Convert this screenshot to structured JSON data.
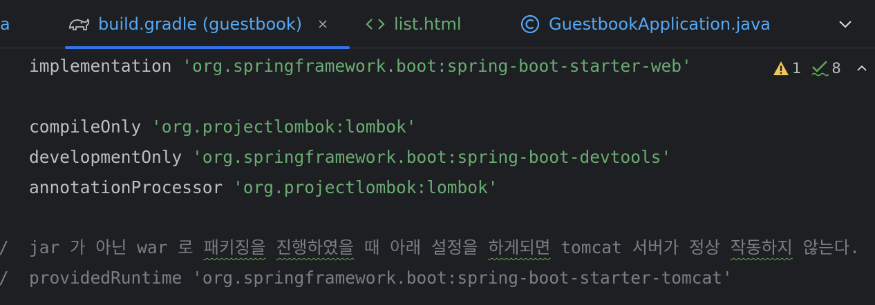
{
  "tabs": {
    "partial_label": "a",
    "active": {
      "label": "build.gradle (guestbook)",
      "icon": "gradle-elephant-icon"
    },
    "list": {
      "label": "list.html",
      "icon": "html-brackets-icon"
    },
    "java": {
      "label": "GuestbookApplication.java",
      "icon": "java-class-icon"
    }
  },
  "inspections": {
    "warnings": "1",
    "checks": "8"
  },
  "code": {
    "line1_kw": "implementation",
    "line1_str": "'org.springframework.boot:spring-boot-starter-web'",
    "line2_kw": "compileOnly",
    "line2_str": "'org.projectlombok:lombok'",
    "line3_kw": "developmentOnly",
    "line3_str": "'org.springframework.boot:spring-boot-devtools'",
    "line4_kw": "annotationProcessor",
    "line4_str": "'org.projectlombok:lombok'",
    "comment1": {
      "p1": "jar 가 아닌 war 로 ",
      "p2": "패키징을",
      "p3": " ",
      "p4": "진행하였을",
      "p5": " 때 아래 설정을 ",
      "p6": "하게되면",
      "p7": " tomcat 서버가 정상 ",
      "p8": "작동하지",
      "p9": " 않는다."
    },
    "comment2": "providedRuntime 'org.springframework.boot:spring-boot-starter-tomcat'",
    "gutter_mark": "/"
  },
  "colors": {
    "background": "#1e1f22",
    "string": "#6aab73",
    "comment": "#7a7e85",
    "accent": "#3574f0",
    "tab_blue": "#56a8f5"
  }
}
